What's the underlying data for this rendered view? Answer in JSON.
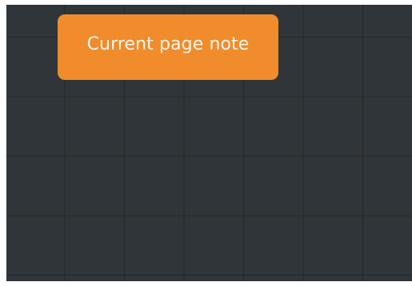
{
  "canvas": {
    "background_color": "#2f3538",
    "grid_line_color": "#262b2d"
  },
  "page_note": {
    "label": "Current page note",
    "background_color": "#f08c2b",
    "text_color": "#fff6ec"
  }
}
